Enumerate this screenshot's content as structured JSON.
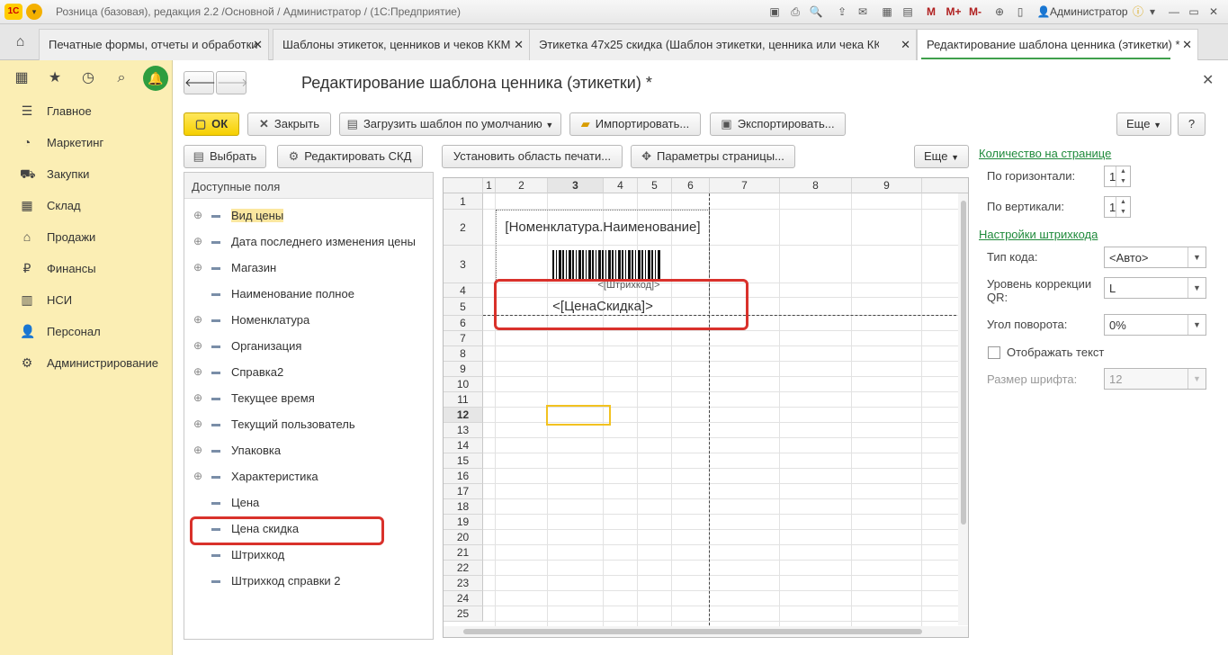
{
  "titlebar": {
    "title": "Розница (базовая), редакция 2.2 /Основной / Администратор /  (1С:Предприятие)",
    "user": "Администратор",
    "logo_text": "1С"
  },
  "tabs": [
    {
      "label": "Печатные формы, отчеты и обработки"
    },
    {
      "label": "Шаблоны этикеток, ценников и чеков ККМ"
    },
    {
      "label": "Этикетка 47х25 скидка (Шаблон этикетки, ценника или чека ККМ)"
    },
    {
      "label": "Редактирование шаблона ценника (этикетки) *"
    }
  ],
  "sidebar": {
    "items": [
      {
        "label": "Главное"
      },
      {
        "label": "Маркетинг"
      },
      {
        "label": "Закупки"
      },
      {
        "label": "Склад"
      },
      {
        "label": "Продажи"
      },
      {
        "label": "Финансы"
      },
      {
        "label": "НСИ"
      },
      {
        "label": "Персонал"
      },
      {
        "label": "Администрирование"
      }
    ]
  },
  "form": {
    "title": "Редактирование шаблона ценника (этикетки) *",
    "toolbar": {
      "ok": "ОК",
      "close": "Закрыть",
      "load_default": "Загрузить шаблон по умолчанию",
      "import": "Импортировать...",
      "export": "Экспортировать...",
      "more": "Еще",
      "help": "?"
    },
    "left_toolbar": {
      "select": "Выбрать",
      "edit_skd": "Редактировать СКД"
    },
    "sheet_toolbar": {
      "set_print_area": "Установить область печати...",
      "page_params": "Параметры страницы...",
      "more": "Еще"
    },
    "fields_panel": {
      "header": "Доступные поля",
      "items": [
        {
          "label": "Вид цены",
          "expandable": true
        },
        {
          "label": "Дата последнего изменения цены",
          "expandable": true
        },
        {
          "label": "Магазин",
          "expandable": true
        },
        {
          "label": "Наименование полное",
          "expandable": false
        },
        {
          "label": "Номенклатура",
          "expandable": true
        },
        {
          "label": "Организация",
          "expandable": true
        },
        {
          "label": "Справка2",
          "expandable": true
        },
        {
          "label": "Текущее время",
          "expandable": true
        },
        {
          "label": "Текущий пользователь",
          "expandable": true
        },
        {
          "label": "Упаковка",
          "expandable": true
        },
        {
          "label": "Характеристика",
          "expandable": true
        },
        {
          "label": "Цена",
          "expandable": false
        },
        {
          "label": "Цена скидка",
          "expandable": false
        },
        {
          "label": "Штрихкод",
          "expandable": false
        },
        {
          "label": "Штрихкод справки 2",
          "expandable": false
        }
      ]
    },
    "sheet": {
      "columns": [
        "1",
        "2",
        "3",
        "4",
        "5",
        "6",
        "7",
        "8",
        "9"
      ],
      "rows": [
        "1",
        "2",
        "3",
        "4",
        "5",
        "6",
        "7",
        "8",
        "9",
        "10",
        "11",
        "12",
        "13",
        "14",
        "15",
        "16",
        "17",
        "18",
        "19",
        "20",
        "21",
        "22",
        "23",
        "24",
        "25"
      ],
      "active_row": "12",
      "active_column": "3",
      "cell_name": "[Номенклатура.Наименование]",
      "cell_barcode_caption": "<[Штрихкод]>",
      "cell_price": "<[ЦенаСкидка]>"
    },
    "settings": {
      "per_page_title": "Количество на странице",
      "horizontal_label": "По горизонтали:",
      "horizontal_value": "1",
      "vertical_label": "По вертикали:",
      "vertical_value": "1",
      "barcode_title": "Настройки штрихкода",
      "code_type_label": "Тип кода:",
      "code_type_value": "<Авто>",
      "qr_level_label": "Уровень коррекции QR:",
      "qr_level_value": "L",
      "rotation_label": "Угол поворота:",
      "rotation_value": "0%",
      "show_text_label": "Отображать текст",
      "font_size_label": "Размер шрифта:",
      "font_size_value": "12"
    }
  },
  "colors": {
    "sidebar_bg": "#fbeeb4",
    "accent_green": "#1f8a3b",
    "ok_yellow": "#f6d000",
    "highlight_red": "#d9312b"
  }
}
